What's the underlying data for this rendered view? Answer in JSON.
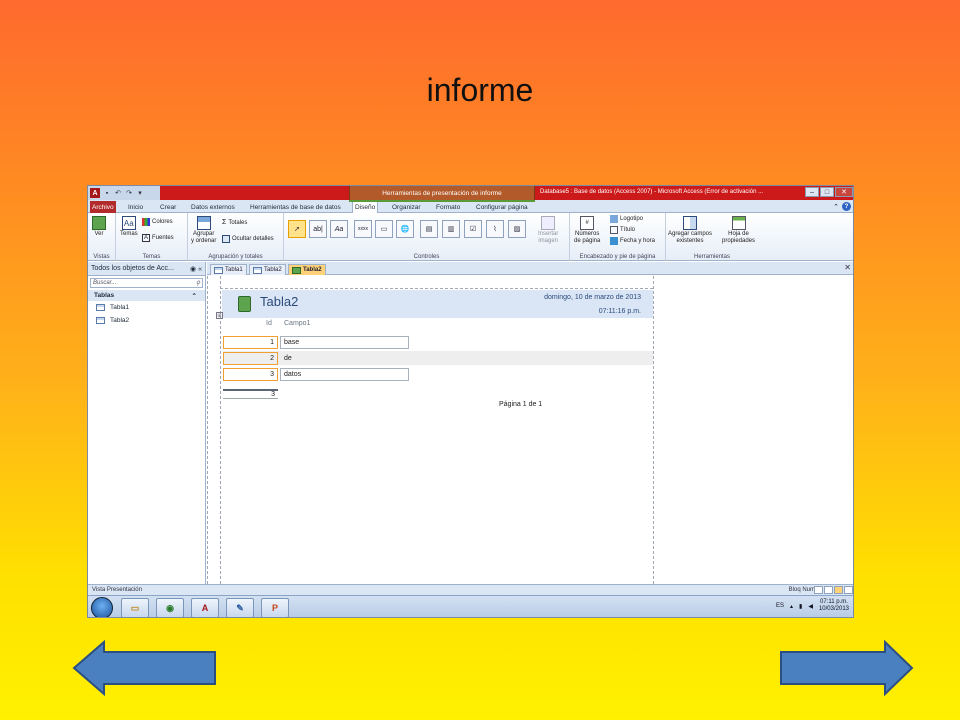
{
  "slide": {
    "title": "informe"
  },
  "titlebar": {
    "context_label": "Herramientas de presentación de informe",
    "window_title": "Database5 : Base de datos (Access 2007) - Microsoft Access (Error de activación ..."
  },
  "ribbon_tabs": [
    "Archivo",
    "Inicio",
    "Crear",
    "Datos externos",
    "Herramientas de base de datos",
    "Diseño",
    "Organizar",
    "Formato",
    "Configurar página"
  ],
  "ribbon_active_tab": "Diseño",
  "ribbon": {
    "vistas": {
      "label": "Vistas",
      "ver": "Ver"
    },
    "temas": {
      "label": "Temas",
      "temas": "Temas",
      "colores": "Colores",
      "fuentes": "Fuentes"
    },
    "agrupacion": {
      "label": "Agrupación y totales",
      "agrupar1": "Agrupar",
      "agrupar2": "y ordenar",
      "totales": "Totales",
      "ocultar": "Ocultar detalles"
    },
    "controles": {
      "label": "Controles",
      "insertar1": "Insertar",
      "insertar2": "imagen"
    },
    "encabezado": {
      "label": "Encabezado y pie de página",
      "numeros1": "Números",
      "numeros2": "de página",
      "logotipo": "Logotipo",
      "titulo": "Título",
      "fecha": "Fecha y hora"
    },
    "herramientas": {
      "label": "Herramientas",
      "agregar1": "Agregar campos",
      "agregar2": "existentes",
      "hoja1": "Hoja de",
      "hoja2": "propiedades"
    }
  },
  "nav": {
    "header": "Todos los objetos de Acc...",
    "search_placeholder": "Buscar...",
    "group": "Tablas",
    "items": [
      "Tabla1",
      "Tabla2"
    ]
  },
  "doc_tabs": [
    "Tabla1",
    "Tabla2",
    "Tabla2"
  ],
  "report": {
    "title": "Tabla2",
    "date": "domingo, 10 de marzo de 2013",
    "time": "07:11:16 p.m.",
    "columns": [
      "Id",
      "Campo1"
    ],
    "rows": [
      {
        "id": "1",
        "campo1": "base"
      },
      {
        "id": "2",
        "campo1": "de"
      },
      {
        "id": "3",
        "campo1": "datos"
      }
    ],
    "total": "3",
    "page_label": "Página 1 de 1"
  },
  "status": {
    "left": "Vista Presentación",
    "right": "Bloq Num"
  },
  "taskbar": {
    "lang": "ES",
    "time": "07:11 p.m.",
    "date": "10/03/2013"
  },
  "colors": {
    "gradient_top": "#ff6a2e",
    "gradient_bottom": "#fff100",
    "arrow_fill": "#4a7fc0",
    "title_bar_red": "#cc1a1a"
  }
}
